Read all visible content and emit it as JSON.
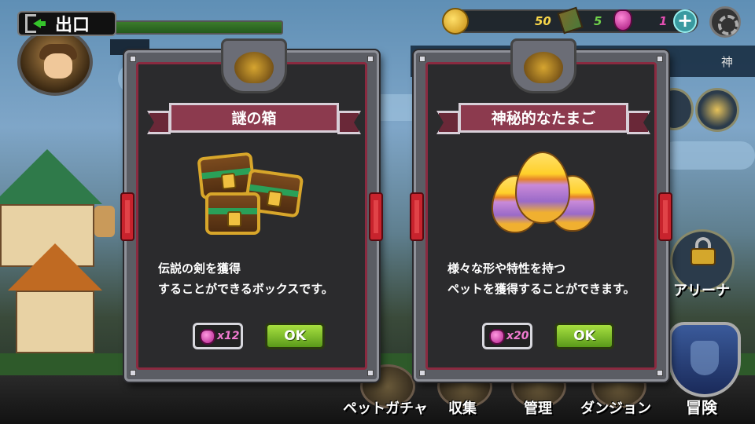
{
  "hud": {
    "exit_label": "出口",
    "hp_fill_percent": 100,
    "resources": {
      "gold": "50",
      "green": "5",
      "gems": "1"
    },
    "side_strip_text": "神"
  },
  "dialogs": [
    {
      "title": "謎の箱",
      "description": "伝説の剣を獲得\nすることができるボックスです。",
      "cost": "x12",
      "ok_label": "OK",
      "art": "treasure-chests"
    },
    {
      "title": "神秘的なたまご",
      "description": "様々な形や特性を持つ\nペットを獲得することができます。",
      "cost": "x20",
      "ok_label": "OK",
      "art": "mystery-eggs"
    }
  ],
  "right_menu": {
    "arena_label": "アリーナ"
  },
  "bottom_nav": {
    "pet_gacha": "ペットガチャ",
    "collection": "収集",
    "manage": "管理",
    "dungeon": "ダンジョン",
    "adventure": "冒険"
  },
  "colors": {
    "panel_frame": "#5b5d64",
    "panel_inner": "#2b2b2d",
    "banner": "#8c3a4e",
    "ok_green": "#a7e040",
    "gem_pink": "#e54fb3"
  },
  "icons": [
    "exit-icon",
    "coin-icon",
    "moss-icon",
    "gem-icon",
    "plus-icon",
    "gear-icon",
    "lock-icon",
    "shield-icon"
  ]
}
